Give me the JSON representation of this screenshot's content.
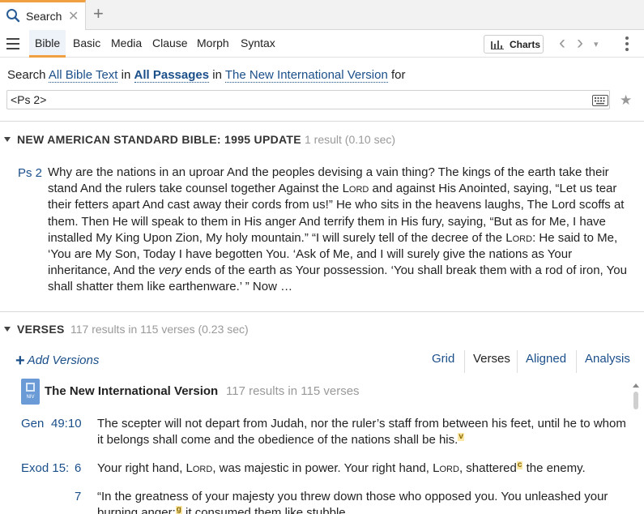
{
  "tab": {
    "label": "Search",
    "close": "✕",
    "new_tab": "+"
  },
  "toolbar": {
    "modes": [
      "Bible",
      "Basic",
      "Media",
      "Clause",
      "Morph",
      "Syntax"
    ],
    "active_mode": "Bible",
    "charts_label": "Charts",
    "back": "‹",
    "forward": "›",
    "dropdown": "▾"
  },
  "search": {
    "prefix": "Search",
    "scope": "All Bible Text",
    "in1": "in",
    "range": "All Passages",
    "in2": "in",
    "version": "The New International Version",
    "suffix": "for",
    "query": "<Ps 2>"
  },
  "nasb": {
    "title": "NEW AMERICAN STANDARD BIBLE: 1995 UPDATE",
    "meta": "1 result (0.10 sec)",
    "ref": "Ps 2",
    "text_part1": "Why are the nations in an uproar And the peoples devising a vain thing? The kings of the earth take their stand And the rulers take counsel together Against the ",
    "lord_1": "Lord",
    "text_part2": " and against His Anointed, saying, “Let us tear their fetters apart And cast away their cords from us!” He who sits in the heavens laughs, The Lord scoffs at them. Then He will speak to them in His anger And terrify them in His fury, saying, “But as for Me, I have installed My King Upon Zion, My holy mountain.” “I will surely tell of the decree of the ",
    "lord_2": "Lord",
    "text_part3": ": He said to Me, ‘You are My Son, Today I have begotten You. ‘Ask of Me, and I will surely give the nations as Your inheritance, And the ",
    "very": "very",
    "text_part4": " ends of the earth as Your possession. ‘You shall break them with a rod of iron, You shall shatter them like earthenware.’ ” Now …"
  },
  "verses": {
    "title": "VERSES",
    "meta": "117 results in 115 verses (0.23 sec)",
    "add_versions": "Add Versions",
    "views": [
      "Grid",
      "Verses",
      "Aligned",
      "Analysis"
    ],
    "active_view": "Verses",
    "version_icon_text": "NIV",
    "version_title": "The New International Version",
    "version_meta": "117 results in 115 verses",
    "items": [
      {
        "book": "Gen",
        "ref": "49:10",
        "text": "The scepter will not depart from Judah, nor the ruler’s staff from between his feet, until he to whom it belongs shall come and the obedience of the nations shall be his.",
        "fn": "v"
      },
      {
        "book": "Exod 15:",
        "ref": "6",
        "t1": "Your right hand, ",
        "lord1": "Lord",
        "t2": ", was majestic in power. Your right hand, ",
        "lord2": "Lord",
        "t3": ", shattered",
        "fn": "c",
        "t4": " the enemy."
      },
      {
        "book": "",
        "ref": "7",
        "t1": "“In the greatness of your majesty you threw down those who opposed you. You unleashed your burning anger;",
        "fn": "g",
        "t2": " it consumed them like stubble."
      }
    ]
  }
}
